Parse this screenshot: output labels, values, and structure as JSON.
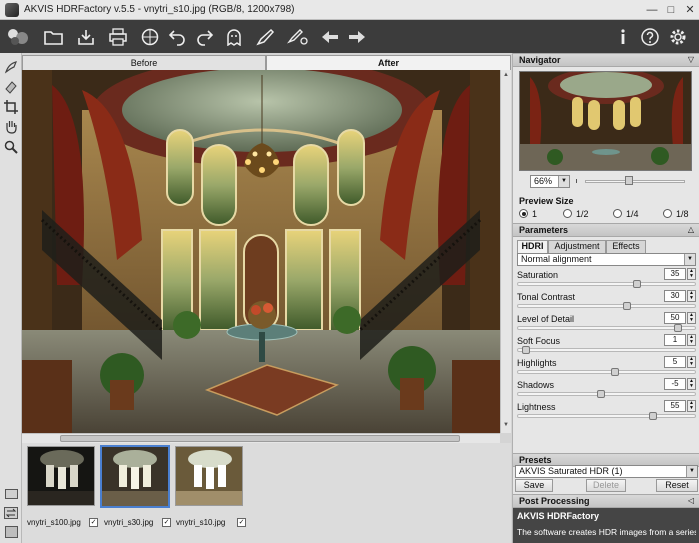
{
  "window": {
    "title": "AKVIS HDRFactory v.5.5 - vnytri_s10.jpg (RGB/8, 1200x798)",
    "minimize": "—",
    "maximize": "□",
    "close": "✕"
  },
  "toolbar": {
    "icons": [
      "app-logo-icon",
      "open-icon",
      "save-icon",
      "print-icon",
      "share-icon",
      "undo-icon",
      "redo-icon",
      "ghost-icon",
      "brush-icon",
      "batch-icon",
      "back-icon",
      "forward-icon",
      "info-icon",
      "help-icon",
      "settings-icon"
    ]
  },
  "left_tools": [
    "eraser-brush-icon",
    "eraser-icon",
    "crop-icon",
    "hand-icon",
    "zoom-icon"
  ],
  "view_tabs": {
    "before": "Before",
    "after": "After"
  },
  "filmstrip": [
    {
      "name": "vnytri_s100.jpg",
      "checked": true,
      "selected": false
    },
    {
      "name": "vnytri_s30.jpg",
      "checked": true,
      "selected": true
    },
    {
      "name": "vnytri_s10.jpg",
      "checked": true,
      "selected": false
    }
  ],
  "navigator": {
    "title": "Navigator",
    "zoom": "66%"
  },
  "preview_size": {
    "title": "Preview Size",
    "options": [
      "1",
      "1/2",
      "1/4",
      "1/8"
    ],
    "selected": "1"
  },
  "parameters": {
    "title": "Parameters",
    "tabs": [
      "HDRI",
      "Adjustment",
      "Effects"
    ],
    "active_tab": "HDRI",
    "alignment": "Normal alignment",
    "items": [
      {
        "label": "Saturation",
        "value": "35",
        "pct": 0.68
      },
      {
        "label": "Tonal Contrast",
        "value": "30",
        "pct": 0.62
      },
      {
        "label": "Level of Detail",
        "value": "50",
        "pct": 0.92
      },
      {
        "label": "Soft Focus",
        "value": "1",
        "pct": 0.03
      },
      {
        "label": "Highlights",
        "value": "5",
        "pct": 0.55
      },
      {
        "label": "Shadows",
        "value": "-5",
        "pct": 0.47
      },
      {
        "label": "Lightness",
        "value": "55",
        "pct": 0.77
      }
    ]
  },
  "presets": {
    "title": "Presets",
    "selected": "AKVIS Saturated HDR (1)",
    "save": "Save",
    "delete": "Delete",
    "reset": "Reset"
  },
  "post_processing": {
    "title": "Post Processing"
  },
  "info": {
    "title": "AKVIS HDRFactory",
    "text": "The software creates HDR images from a series"
  },
  "colors": {
    "toolbar_bg": "#3c3c3c",
    "accent": "#4a7fd0"
  }
}
